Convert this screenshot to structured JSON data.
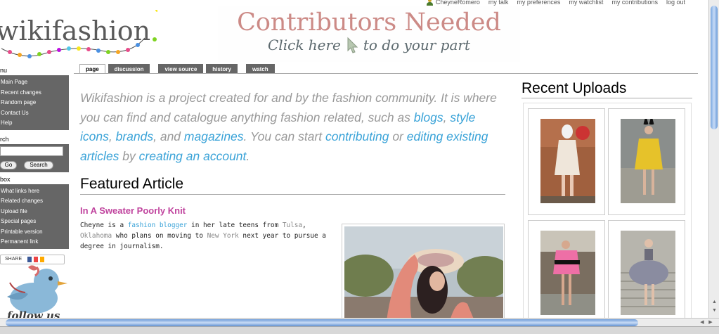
{
  "user_links": {
    "username": "CheyneRomero",
    "items": [
      "my talk",
      "my preferences",
      "my watchlist",
      "my contributions",
      "log out"
    ]
  },
  "logo": {
    "text": "wikifashion"
  },
  "banner": {
    "title": "Contributors Needed",
    "sub_before": "Click here",
    "sub_after": "to do your part"
  },
  "tabs": [
    {
      "label": "page"
    },
    {
      "label": "discussion"
    },
    {
      "label": "view source"
    },
    {
      "label": "history"
    },
    {
      "label": "watch"
    }
  ],
  "sidebar": {
    "nav_title": "nu",
    "nav_items": [
      "Main Page",
      "Recent changes",
      "Random page",
      "Contact Us",
      "Help"
    ],
    "search_title": "rch",
    "go_label": "Go",
    "search_label": "Search",
    "toolbox_title": "box",
    "toolbox_items": [
      "What links here",
      "Related changes",
      "Upload file",
      "Special pages",
      "Printable version",
      "Permanent link"
    ],
    "share_label": "SHARE",
    "follow_text": "follow us"
  },
  "intro": {
    "t1": "Wikifashion is a project created for and by the fashion community. It is where you can find and catalogue anything fashion related, such as ",
    "l_blogs": "blogs",
    "t2": ", ",
    "l_style_icons": "style icons",
    "t3": ", ",
    "l_brands": "brands",
    "t4": ", and ",
    "l_magazines": "magazines",
    "t5": ". You can start ",
    "l_contributing": "contributing",
    "t6": " or ",
    "l_editing": "editing existing articles",
    "t7": " by ",
    "l_creating": "creating an account",
    "t8": "."
  },
  "featured": {
    "heading": "Featured Article",
    "title": "In A Sweater Poorly Knit",
    "b1": "Cheyne is a ",
    "l_fashion_blogger": "fashion blogger",
    "b2": " in her late teens from ",
    "l_tulsa": "Tulsa",
    "b3": ", ",
    "l_oklahoma": "Oklahoma",
    "b4": " who plans on moving to ",
    "l_new_york": "New York",
    "b5": " next year to pursue a degree in journalism."
  },
  "uploads": {
    "heading": "Recent Uploads"
  },
  "colors": {
    "link": "#3aa3d8",
    "article_title": "#c0449e",
    "banner_title": "#cc8a86",
    "sidebar_bg": "#666666"
  }
}
